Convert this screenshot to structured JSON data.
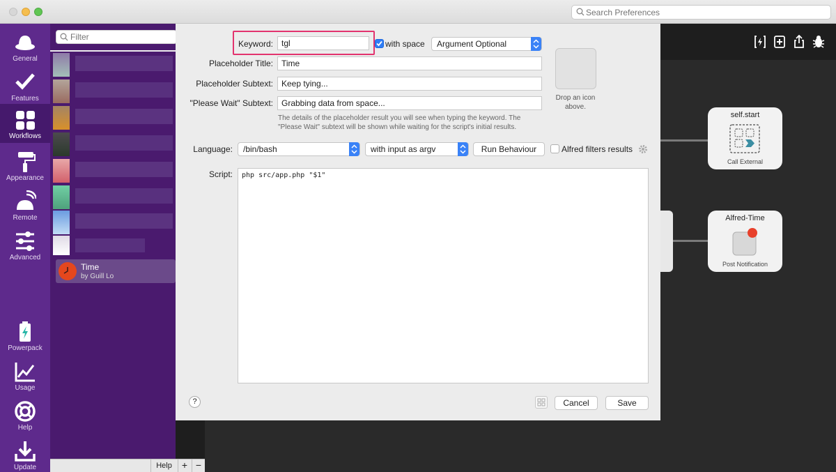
{
  "titlebar": {
    "search_placeholder": "Search Preferences"
  },
  "sidebar": {
    "items": [
      {
        "label": "General",
        "icon": "hat-icon"
      },
      {
        "label": "Features",
        "icon": "checkmark-icon"
      },
      {
        "label": "Workflows",
        "icon": "grid-icon"
      },
      {
        "label": "Appearance",
        "icon": "paint-roller-icon"
      },
      {
        "label": "Remote",
        "icon": "remote-icon"
      },
      {
        "label": "Advanced",
        "icon": "sliders-icon"
      },
      {
        "label": "Powerpack",
        "icon": "battery-icon"
      },
      {
        "label": "Usage",
        "icon": "chart-icon"
      },
      {
        "label": "Help",
        "icon": "lifebuoy-icon"
      },
      {
        "label": "Update",
        "icon": "download-icon"
      }
    ],
    "active": "Workflows"
  },
  "workflows": {
    "filter_placeholder": "Filter",
    "selected": {
      "name": "Time",
      "author": "by Guill Lo"
    },
    "bottom": {
      "help_label": "Help",
      "plus": "+",
      "minus": "−"
    }
  },
  "form": {
    "keyword_label": "Keyword:",
    "keyword_value": "tgl",
    "with_space_label": "with space",
    "with_space_checked": true,
    "argument_option": "Argument Optional",
    "placeholder_title_label": "Placeholder Title:",
    "placeholder_title_value": "Time",
    "placeholder_subtext_label": "Placeholder Subtext:",
    "placeholder_subtext_value": "Keep tying...",
    "please_wait_label": "\"Please Wait\" Subtext:",
    "please_wait_value": "Grabbing data from space...",
    "description": "The details of the placeholder result you will see when typing the keyword. The \"Please Wait\" subtext will be shown while waiting for the script's initial results.",
    "drop_icon_text": "Drop an icon above.",
    "language_label": "Language:",
    "language_value": "/bin/bash",
    "input_mode": "with input as argv",
    "run_behaviour_label": "Run Behaviour",
    "alfred_filters_label": "Alfred filters results",
    "alfred_filters_checked": false,
    "script_label": "Script:",
    "script_value": "php src/app.php \"$1\"",
    "help_label": "?",
    "cancel_label": "Cancel",
    "save_label": "Save"
  },
  "canvas": {
    "nodes": [
      {
        "title": "self.start",
        "subtitle": "Call External"
      },
      {
        "title": "Alfred-Time",
        "subtitle": "Post Notification"
      }
    ]
  },
  "colors": {
    "sidebar_bg": "#5e2a8c",
    "highlight_box": "#e2336e",
    "accent_blue": "#2f7df6"
  }
}
